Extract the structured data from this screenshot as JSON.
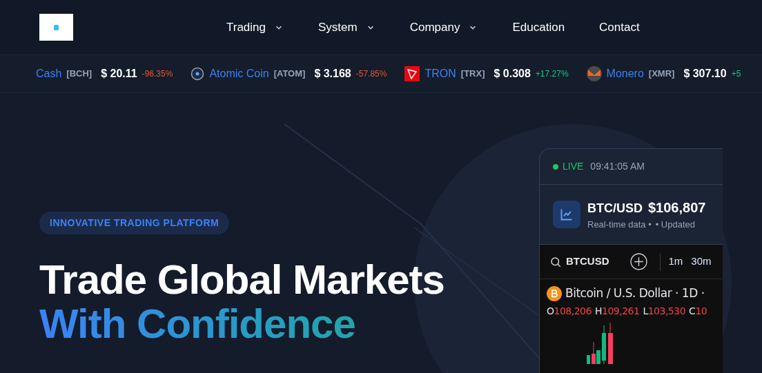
{
  "nav": [
    {
      "label": "Trading",
      "has_menu": true
    },
    {
      "label": "System",
      "has_menu": true
    },
    {
      "label": "Company",
      "has_menu": true
    },
    {
      "label": "Education",
      "has_menu": false
    },
    {
      "label": "Contact",
      "has_menu": false
    }
  ],
  "ticker": [
    {
      "kind": "plain",
      "name": "Cash",
      "symbol": "[BCH]",
      "price": "$ 20.11",
      "change": "-96.35%",
      "color": "#e4572e"
    },
    {
      "kind": "atom",
      "name": "Atomic Coin",
      "symbol": "[ATOM]",
      "price": "$ 3.168",
      "change": "-57.85%",
      "color": "#e4572e"
    },
    {
      "kind": "tron",
      "name": "TRON",
      "symbol": "[TRX]",
      "price": "$ 0.308",
      "change": "+17.27%",
      "color": "#16c784"
    },
    {
      "kind": "monero",
      "name": "Monero",
      "symbol": "[XMR]",
      "price": "$ 307.10",
      "change": "+5",
      "color": "#16c784"
    }
  ],
  "hero": {
    "badge": "INNOVATIVE TRADING PLATFORM",
    "title_line_1": "Trade Global Markets",
    "title_line_2": "With Confidence"
  },
  "card": {
    "status": "LIVE",
    "time": "09:41:05 AM",
    "pair": "BTC/USD",
    "price": "$106,807",
    "subtitle_1": "Real-time data •",
    "subtitle_2": "• Updated",
    "symbol": "BTCUSD",
    "intervals": [
      "1m",
      "30m"
    ],
    "instrument": "Bitcoin / U.S. Dollar · 1D ·",
    "ohlc": [
      {
        "key": "O",
        "value": "108,206"
      },
      {
        "key": "H",
        "value": "109,261"
      },
      {
        "key": "L",
        "value": "103,530"
      },
      {
        "key": "C",
        "value": "10"
      }
    ]
  }
}
